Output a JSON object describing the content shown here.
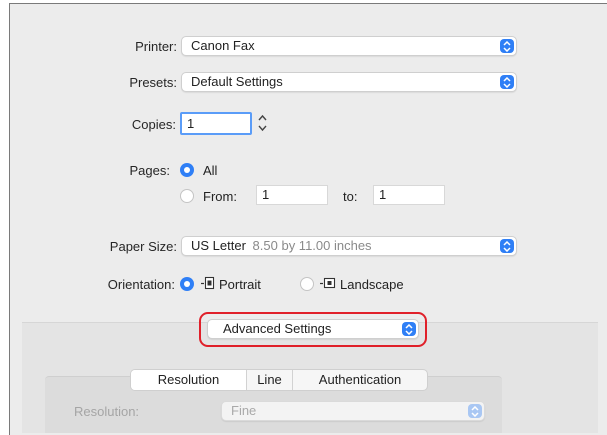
{
  "printer": {
    "label": "Printer:",
    "value": "Canon Fax"
  },
  "presets": {
    "label": "Presets:",
    "value": "Default Settings"
  },
  "copies": {
    "label": "Copies:",
    "value": "1"
  },
  "pages": {
    "label": "Pages:",
    "all_label": "All",
    "from_label": "From:",
    "from_value": "1",
    "to_label": "to:",
    "to_value": "1",
    "selected": "All"
  },
  "paper_size": {
    "label": "Paper Size:",
    "value": "US Letter",
    "detail": "8.50 by 11.00 inches"
  },
  "orientation": {
    "label": "Orientation:",
    "portrait_label": "Portrait",
    "landscape_label": "Landscape",
    "selected": "Portrait"
  },
  "section_popup": {
    "value": "Advanced Settings",
    "highlight_color": "#e0202a"
  },
  "tabs": [
    {
      "label": "Resolution",
      "selected": true
    },
    {
      "label": "Line",
      "selected": false
    },
    {
      "label": "Authentication",
      "selected": false
    }
  ],
  "resolution": {
    "label": "Resolution:",
    "value": "Fine"
  },
  "colors": {
    "accent": "#2f7ff6",
    "window_bg": "#ececec",
    "highlight": "#e0202a"
  }
}
